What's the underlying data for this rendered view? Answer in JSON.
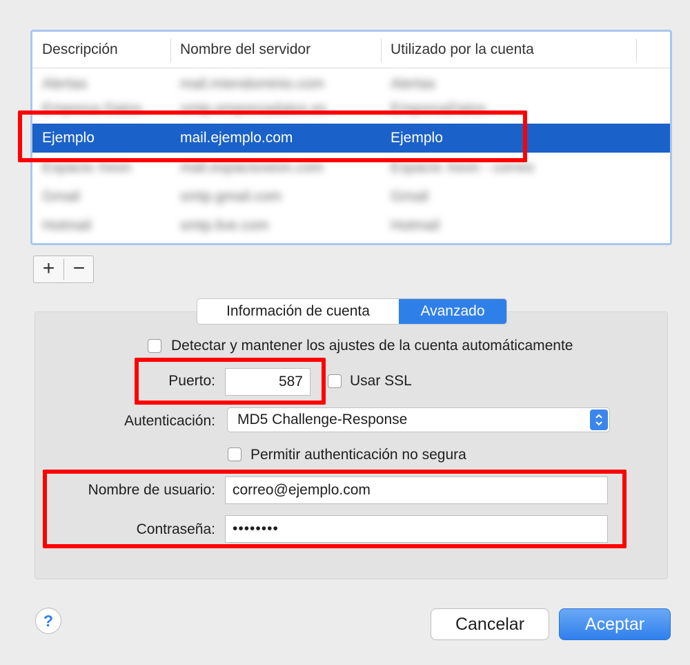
{
  "table": {
    "columns": [
      "Descripción",
      "Nombre del servidor",
      "Utilizado por la cuenta"
    ],
    "rows": [
      {
        "description": "Alertas",
        "server": "mail.miendominio.com",
        "account": "Alertas",
        "blurred": true
      },
      {
        "description": "Empresa Datos",
        "server": "smtp.empresadatos.es",
        "account": "EmpresaDatos",
        "blurred": true
      },
      {
        "description": "Ejemplo",
        "server": "mail.ejemplo.com",
        "account": "Ejemplo",
        "blurred": false,
        "selected": true
      },
      {
        "description": "Espacio Xeon",
        "server": "mail.espacioxeon.com",
        "account": "Espacio Xeon - correo",
        "blurred": true
      },
      {
        "description": "Gmail",
        "server": "smtp.gmail.com",
        "account": "Gmail",
        "blurred": true
      },
      {
        "description": "Hotmail",
        "server": "smtp.live.com",
        "account": "Hotmail",
        "blurred": true
      }
    ]
  },
  "buttons": {
    "add": "+",
    "remove": "−",
    "cancel": "Cancelar",
    "ok": "Aceptar",
    "help": "?"
  },
  "tabs": [
    "Información de cuenta",
    "Avanzado"
  ],
  "active_tab": "Avanzado",
  "advanced": {
    "auto_detect_label": "Detectar y mantener los ajustes de la cuenta automáticamente",
    "auto_detect_checked": false,
    "port_label": "Puerto:",
    "port_value": "587",
    "ssl_label": "Usar SSL",
    "ssl_checked": false,
    "auth_label": "Autenticación:",
    "auth_value": "MD5 Challenge-Response",
    "insecure_label": "Permitir authenticación no segura",
    "insecure_checked": false,
    "username_label": "Nombre de usuario:",
    "username_value": "correo@ejemplo.com",
    "password_label": "Contraseña:",
    "password_value": "••••••••"
  },
  "colors": {
    "selection": "#1a61c9",
    "accent": "#2f7fe9",
    "highlight_box": "#ff0000"
  }
}
